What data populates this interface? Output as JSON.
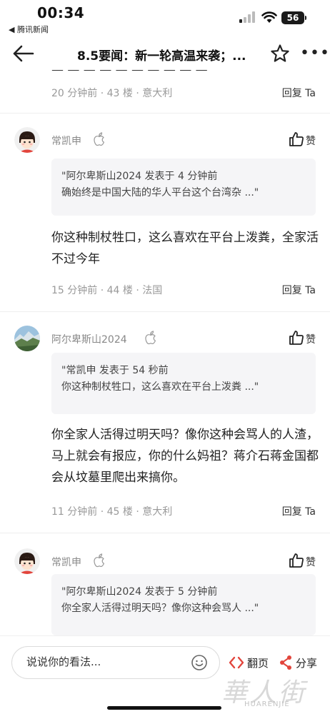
{
  "status": {
    "time": "00:34",
    "back_app": "◀ 腾讯新闻",
    "battery": "56"
  },
  "nav": {
    "title": "8.5要闻：新一轮高温来袭；..."
  },
  "top_comment": {
    "meta": "20 分钟前 · 43 楼 · 意大利",
    "reply": "回复 Ta"
  },
  "comments": [
    {
      "user": "常凯申",
      "like": "赞",
      "quote_line1": "\"阿尔卑斯山2024 发表于 4 分钟前",
      "quote_line2": "确始终是中国大陆的华人平台这个台湾杂 ...\"",
      "text": "你这种制杖牲口，这么喜欢在平台上泼粪，全家活不过今年",
      "meta": "15 分钟前 · 44 楼 · 法国",
      "reply": "回复 Ta"
    },
    {
      "user": "阿尔卑斯山2024",
      "like": "赞",
      "quote_line1": "\"常凯申 发表于 54 秒前",
      "quote_line2": "你这种制杖牲口，这么喜欢在平台上泼粪 ...\"",
      "text": "你全家人活得过明天吗？像你这种会骂人的人渣，马上就会有报应，你的什么妈祖？蒋介石蒋金国都会从坟墓里爬出来搞你。",
      "meta": "11 分钟前 · 45 楼 · 意大利",
      "reply": "回复 Ta"
    },
    {
      "user": "常凯申",
      "like": "赞",
      "quote_line1": "\"阿尔卑斯山2024 发表于 5 分钟前",
      "quote_line2": "你全家人活得过明天吗？像你这种会骂人 ...\""
    }
  ],
  "bottom": {
    "placeholder": "说说你的看法...",
    "flip_label": "翻页",
    "share_label": "分享",
    "watermark": "華人街",
    "watermark_sub": "HUARENJIE"
  }
}
